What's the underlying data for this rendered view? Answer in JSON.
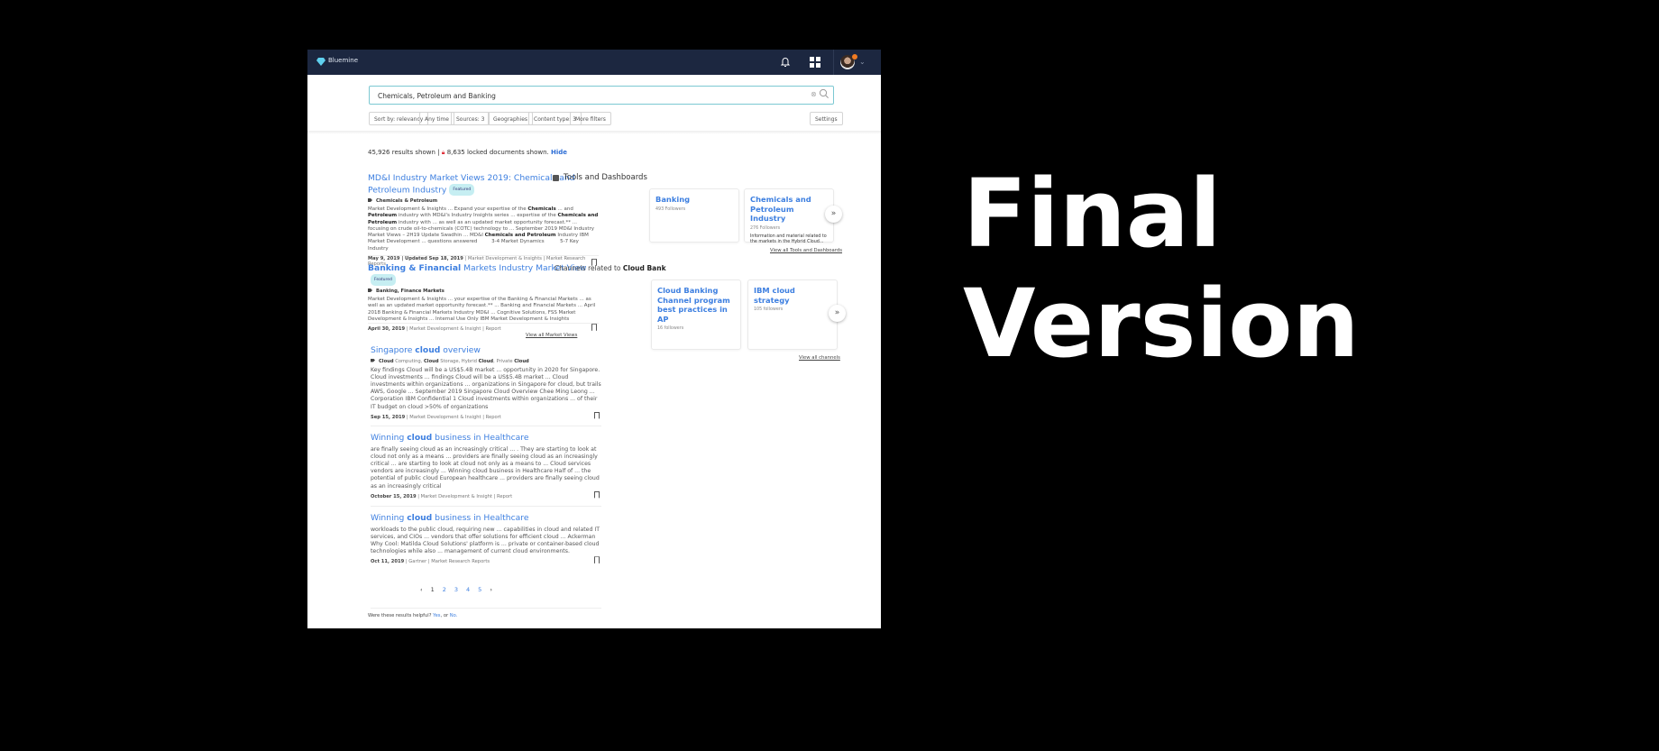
{
  "app": {
    "brand": "Bluemine"
  },
  "search": {
    "value": "Chemicals, Petroleum and Banking"
  },
  "filters": [
    "Sort by: relevancy",
    "Any time",
    "Sources: 3",
    "Geographies",
    "Content type: 3",
    "More filters"
  ],
  "settings_label": "Settings",
  "summary": {
    "results": "45,926 results shown |",
    "locked": "8,635 locked documents shown.",
    "hide": "Hide"
  },
  "results": [
    {
      "title": [
        {
          "t": "MD&I Industry Market Views 2019: Chemicals and Petroleum Industry",
          "b": false
        }
      ],
      "featured": "Featured",
      "tags": [
        {
          "t": "Chemicals & Petroleum",
          "b": true
        }
      ],
      "snippet": [
        {
          "t": "Market Development & Insights ... Expand your expertise of the ",
          "b": false
        },
        {
          "t": "Chemicals",
          "b": true
        },
        {
          "t": " ... and ",
          "b": false
        },
        {
          "t": "Petroleum",
          "b": true
        },
        {
          "t": " industry with MD&I's Industry Insights series ... expertise of the ",
          "b": false
        },
        {
          "t": "Chemicals and Petroleum",
          "b": true
        },
        {
          "t": " industry with ... as well as an updated market opportunity forecast.** ... focusing on crude oil-to-chemicals (COTC) technology to ... September 2019 MD&I Industry Market Views – 2H19 Update Swadhin ... MD&I ",
          "b": false
        },
        {
          "t": "Chemicals and Petroleum",
          "b": true
        },
        {
          "t": " Industry IBM Market Development ... questions answered         3-4 Market Dynamics          5-7 Key Industry",
          "b": false
        }
      ],
      "date": "May 9, 2019 | Updated Sep 18, 2019",
      "source": " | Market Development & Insights | Market Research Reports"
    },
    {
      "title": [
        {
          "t": "Banking & Financial",
          "b": true
        },
        {
          "t": " Markets Industry Market View",
          "b": false
        }
      ],
      "featured": "Featured",
      "tags": [
        {
          "t": "Banking, Finance Markets",
          "b": true
        }
      ],
      "snippet": [
        {
          "t": "Market Development & Insights ... your expertise of the Banking & Financial Markets ... as well as an updated market opportunity forecast.** ... Banking and Financial Markets ... April 2018 Banking & Financial Markets Industry MD&I ... Cognitive Solutions, FSS Market Development & Insights ... Internal Use Only IBM Market Development & Insights",
          "b": false
        }
      ],
      "date": "April 30, 2019",
      "source": " | Market Development & Insight | Report"
    },
    {
      "title": [
        {
          "t": "Singapore ",
          "b": false
        },
        {
          "t": "cloud",
          "b": true
        },
        {
          "t": " overview",
          "b": false
        }
      ],
      "tags": [
        {
          "t": "Cloud",
          "b": true
        },
        {
          "t": " Computing, ",
          "b": false
        },
        {
          "t": "Cloud",
          "b": true
        },
        {
          "t": " Storage, Hybrid ",
          "b": false
        },
        {
          "t": "Cloud",
          "b": true
        },
        {
          "t": ", Private ",
          "b": false
        },
        {
          "t": "Cloud",
          "b": true
        }
      ],
      "snippet": [
        {
          "t": "Key findings Cloud will be a US$5.4B market ... opportunity in 2020 for Singapore. Cloud investments ... findings Cloud will be a US$5.4B market ... Cloud investments within organizations ... organizations in Singapore for cloud, but trails AWS, Google ... September 2019 Singapore Cloud Overview Chee Ming Leong ... Corporation IBM Confidential 1 Cloud investments within organizations ... of their IT budget on cloud >50% of organizations",
          "b": false
        }
      ],
      "date": "Sep 15, 2019",
      "source": " | Market Development & Insight | Report"
    },
    {
      "title": [
        {
          "t": "Winning ",
          "b": false
        },
        {
          "t": "cloud",
          "b": true
        },
        {
          "t": " business in Healthcare",
          "b": false
        }
      ],
      "snippet": [
        {
          "t": "are finally seeing cloud as an increasingly critical ... . They are starting to look at cloud not only as a means ... providers are finally seeing cloud as an increasingly critical ... are starting to look at cloud not only as a means to ... Cloud services vendors are increasingly ... Winning cloud business in Healthcare Half of ... the potential of public cloud European healthcare ... providers are finally seeing cloud as an increasingly critical",
          "b": false
        }
      ],
      "date": "October 15, 2019",
      "source": " | Market Development & Insight | Report"
    },
    {
      "title": [
        {
          "t": "Winning ",
          "b": false
        },
        {
          "t": "cloud",
          "b": true
        },
        {
          "t": " business in Healthcare",
          "b": false
        }
      ],
      "snippet": [
        {
          "t": "workloads to the public cloud, requiring new ... capabilities in cloud and related IT services, and CIOs ... vendors that offer solutions for efficient cloud ... Ackerman Why Cool: Matilda Cloud Solutions' platform is ... private or container-based cloud technologies while also ... management of current cloud environments.",
          "b": false
        }
      ],
      "date": "Oct 11, 2019",
      "source": " | Gartner | Market Research Reports"
    }
  ],
  "view_all_market_views": "View all Market Views",
  "pagination": {
    "pages": [
      "1",
      "2",
      "3",
      "4",
      "5"
    ],
    "current": "1",
    "prev": "‹",
    "next": "›"
  },
  "helpful": {
    "q": "Were these results helpful?",
    "yes": "Yes",
    "sep": ", or",
    "no": "No."
  },
  "tools": {
    "heading": "Tools and Dashboards",
    "cards": [
      {
        "title": "Banking",
        "followers": "493 Followers"
      },
      {
        "title": "Chemicals and Petroleum Industry",
        "followers": "276 Followers",
        "desc": "Information and material related to the markets in the Hybrid Cloud..."
      }
    ],
    "view_all": "View all Tools and Dashboards"
  },
  "channels": {
    "heading": "Channels related to",
    "topic": "Cloud Bank",
    "cards": [
      {
        "title": "Cloud Banking Channel program best practices in AP",
        "followers": "16 followers"
      },
      {
        "title": "IBM cloud strategy",
        "followers": "105 followers"
      }
    ],
    "view_all": "View all channels"
  },
  "arrow_glyph": "»",
  "overlay": {
    "line1": "Final",
    "line2": "Version"
  }
}
